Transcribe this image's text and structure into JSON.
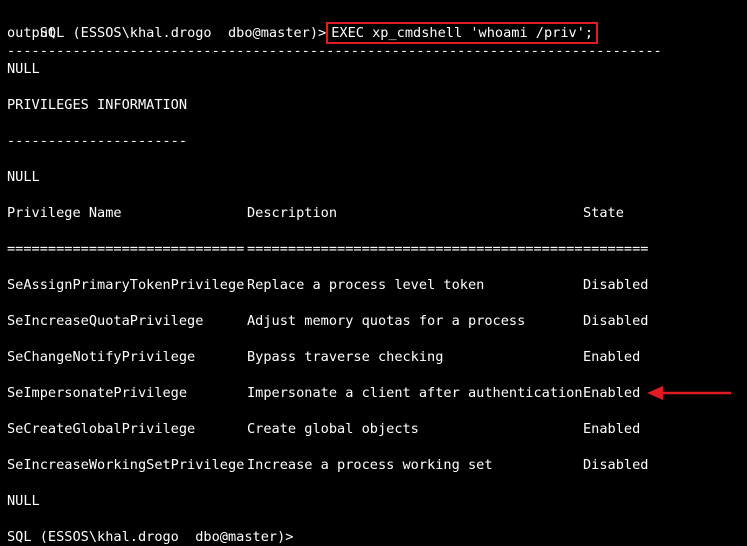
{
  "terminal": {
    "prompt": "SQL (ESSOS\\khal.drogo  dbo@master)>",
    "command": "EXEC xp_cmdshell 'whoami /priv';",
    "output_header": "output",
    "separator_long": "--------------------------------------------------------------------------------",
    "null_1": "NULL",
    "section_title": "PRIVILEGES INFORMATION",
    "separator_short": "----------------------",
    "null_2": "NULL",
    "table": {
      "headers": [
        "Privilege Name",
        "Description",
        "State"
      ],
      "underlines": [
        "=============================",
        "=========================================",
        "========"
      ],
      "rows": [
        {
          "name": "SeAssignPrimaryTokenPrivilege",
          "description": "Replace a process level token",
          "state": "Disabled"
        },
        {
          "name": "SeIncreaseQuotaPrivilege",
          "description": "Adjust memory quotas for a process",
          "state": "Disabled"
        },
        {
          "name": "SeChangeNotifyPrivilege",
          "description": "Bypass traverse checking",
          "state": "Enabled"
        },
        {
          "name": "SeImpersonatePrivilege",
          "description": "Impersonate a client after authentication",
          "state": "Enabled"
        },
        {
          "name": "SeCreateGlobalPrivilege",
          "description": "Create global objects",
          "state": "Enabled"
        },
        {
          "name": "SeIncreaseWorkingSetPrivilege",
          "description": "Increase a process working set",
          "state": "Disabled"
        }
      ]
    },
    "null_3": "NULL",
    "final_prompt": "SQL (ESSOS\\khal.drogo  dbo@master)>"
  },
  "colors": {
    "background": "#000000",
    "text": "#ffffff",
    "highlight": "#e01b24"
  },
  "annotation": {
    "icon": "red-arrow-icon",
    "points_to_row": 3
  }
}
